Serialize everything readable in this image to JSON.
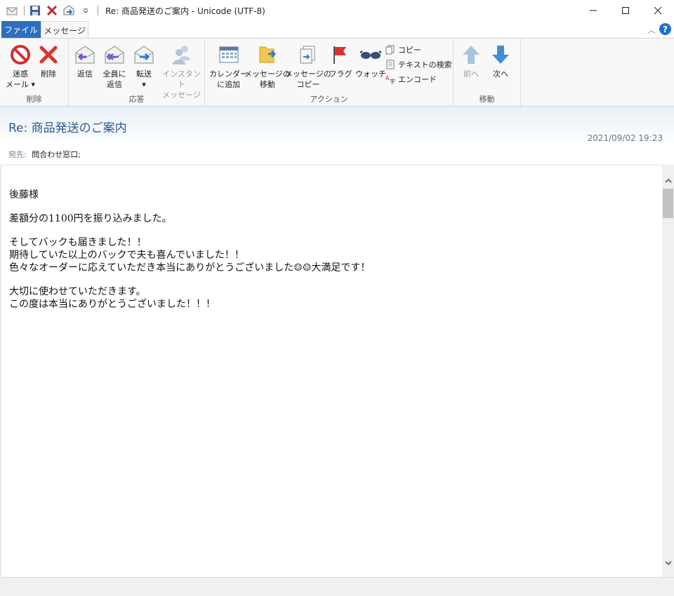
{
  "window": {
    "title": "Re: 商品発送のご案内 - Unicode (UTF-8)"
  },
  "tabs": {
    "file": "ファイル",
    "message": "メッセージ"
  },
  "ribbon": {
    "delete_group": {
      "label": "削除",
      "junk": "迷惑\nメール ▾",
      "delete": "削除"
    },
    "reply_group": {
      "label": "応答",
      "reply": "返信",
      "reply_all": "全員に\n返信",
      "forward": "転送\n▾",
      "im": "インスタント\nメッセージ"
    },
    "action_group": {
      "label": "アクション",
      "calendar": "カレンダー\nに追加",
      "move": "メッセージの\n移動",
      "copy_msg": "メッセージの\nコピー",
      "flag": "フラグ",
      "watch": "ウォッチ",
      "copy": "コピー",
      "find_text": "テキストの検索",
      "encode": "エンコード"
    },
    "move_group": {
      "label": "移動",
      "prev": "前へ",
      "next": "次へ"
    }
  },
  "header": {
    "subject": "Re: 商品発送のご案内",
    "date": "2021/09/02 19:23",
    "to_label": "宛先:",
    "to_value": "問合わせ窓口;"
  },
  "message": {
    "greeting": "後藤様",
    "line1": "差額分の1100円を振り込みました。",
    "line2": "そしてバックも届きました！！",
    "line3": "期待していた以上のバックで夫も喜んでいました！！",
    "line4": "色々なオーダーに応えていただき本当にありがとうございました☺☺大満足です！",
    "line5": "大切に使わせていただきます。",
    "line6": "この度は本当にありがとうございました！！！"
  },
  "colors": {
    "accent": "#2b6fbe",
    "subject": "#2c5b8f",
    "flag": "#d9312b",
    "arrow": "#3f8fd8"
  }
}
